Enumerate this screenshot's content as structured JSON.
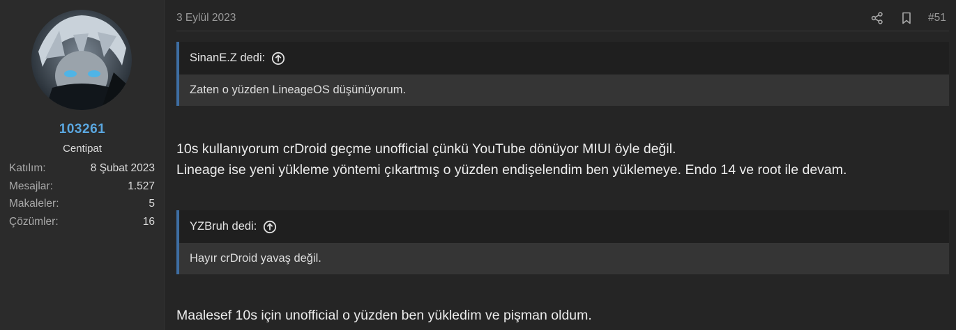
{
  "user": {
    "username": "103261",
    "title": "Centipat",
    "stats": [
      {
        "label": "Katılım:",
        "value": "8 Şubat 2023"
      },
      {
        "label": "Mesajlar:",
        "value": "1.527"
      },
      {
        "label": "Makaleler:",
        "value": "5"
      },
      {
        "label": "Çözümler:",
        "value": "16"
      }
    ]
  },
  "post": {
    "date": "3 Eylül 2023",
    "number": "#51",
    "icons": {
      "share": "share-icon",
      "bookmark": "bookmark-icon"
    },
    "quotes": [
      {
        "author_line": "SinanE.Z dedi:",
        "text": "Zaten o yüzden LineageOS düşünüyorum."
      },
      {
        "author_line": "YZBruh dedi:",
        "text": "Hayır crDroid yavaş değil."
      }
    ],
    "paragraphs": [
      "10s kullanıyorum crDroid geçme unofficial çünkü YouTube dönüyor MIUI öyle değil.",
      "Lineage ise yeni yükleme yöntemi çıkartmış o yüzden endişelendim ben yüklemeye. Endo 14 ve root ile devam.",
      "Maalesef 10s için unofficial o yüzden ben yükledim ve pişman oldum."
    ]
  },
  "colors": {
    "accent": "#5aa7e0",
    "quote_border": "#3e6ea3",
    "background": "#252525"
  }
}
